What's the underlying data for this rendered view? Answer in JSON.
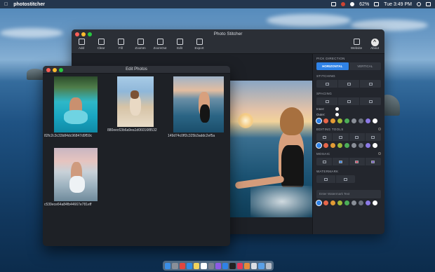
{
  "menubar": {
    "app_name": "photostitcher",
    "battery": "62%",
    "clock": "Tue 3:49 PM"
  },
  "main_window": {
    "title": "Photo Stitcher",
    "toolbar": [
      {
        "label": "Add",
        "icon": "folder-icon"
      },
      {
        "label": "Clear",
        "icon": "trash-icon"
      },
      {
        "label": "Fill",
        "icon": "layers-icon"
      },
      {
        "label": "ZoomIn",
        "icon": "zoom-in-icon"
      },
      {
        "label": "ZoomOut",
        "icon": "zoom-out-icon"
      },
      {
        "label": "Edit",
        "icon": "edit-icon"
      },
      {
        "label": "Export",
        "icon": "export-icon"
      }
    ],
    "toolbar_right": [
      {
        "label": "Website",
        "icon": "website-icon"
      },
      {
        "label": "About",
        "icon": "about-icon"
      }
    ]
  },
  "panel": {
    "pick_direction": {
      "title": "PICK DIRECTION",
      "options": [
        "HORIZONTAL",
        "VERTICAL"
      ],
      "selected": "HORIZONTAL"
    },
    "stitching": {
      "title": "STITCHING"
    },
    "spacing": {
      "title": "SPACING",
      "inner_label": "Inner:",
      "outer_label": "Outer:"
    },
    "editing_tools": {
      "title": "EDITING TOOLS"
    },
    "mosaic": {
      "title": "MOSAIC"
    },
    "watermark": {
      "title": "WATERMARK",
      "placeholder": "Enter Watermark Text"
    },
    "palette": [
      "#2f82e6",
      "#e7664a",
      "#e39b35",
      "#9fba3a",
      "#4cae57",
      "#8a8f98",
      "#6e7480",
      "#8c7ae6",
      "#ffffff"
    ]
  },
  "edit_window": {
    "title": "Edit Photos",
    "photos": [
      {
        "name": "82fc2c3c33b84dc96847d9f59c"
      },
      {
        "name": "880eec63b6a9ea1d06016f8532"
      },
      {
        "name": "149d74c0ff2c325b3addc2ef5a"
      },
      {
        "name": "c539ece64a84fb44667e781eff"
      }
    ]
  }
}
